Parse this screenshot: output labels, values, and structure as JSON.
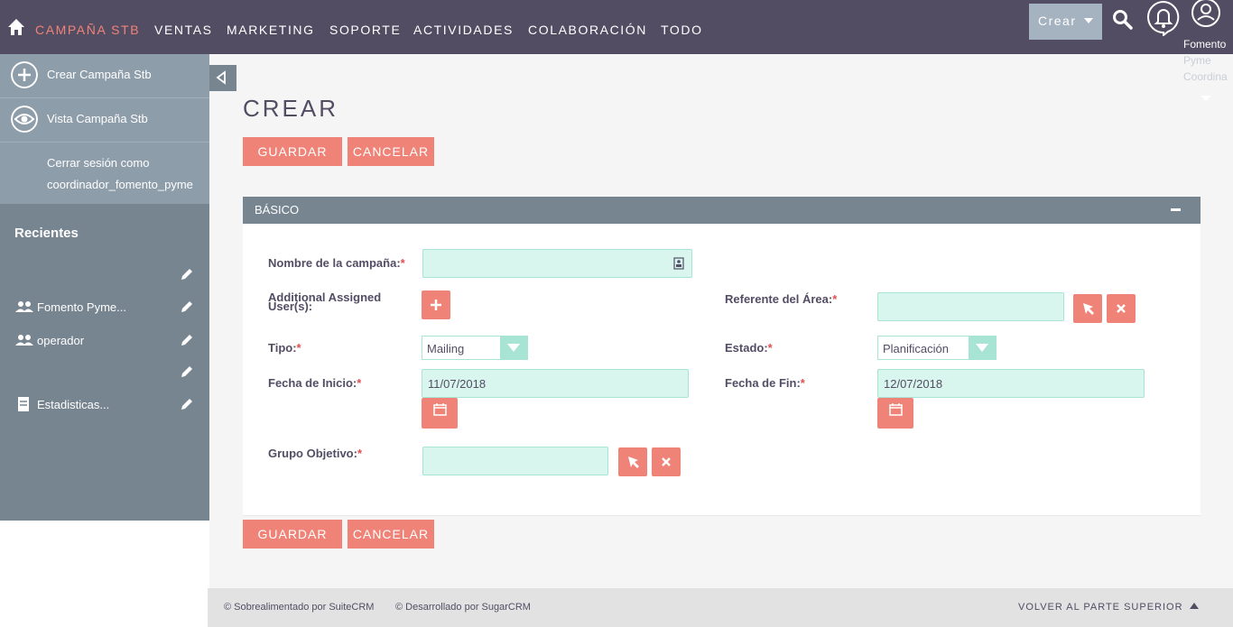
{
  "nav": {
    "home": "home-icon",
    "items": [
      {
        "label": "CAMPAÑA STB",
        "active": true
      },
      {
        "label": "VENTAS"
      },
      {
        "label": "MARKETING"
      },
      {
        "label": "SOPORTE"
      },
      {
        "label": "ACTIVIDADES"
      },
      {
        "label": "COLABORACIÓN"
      },
      {
        "label": "TODO"
      }
    ],
    "create_label": "Crear",
    "user_lines": [
      "Fomento",
      "Pyme",
      "Coordina"
    ]
  },
  "sidebar": {
    "actions": [
      {
        "label": "Crear Campaña Stb",
        "icon": "plus-circle-icon"
      },
      {
        "label": "Vista Campaña Stb",
        "icon": "eye-icon"
      }
    ],
    "logout": [
      "Cerrar sesión como",
      "coordinador_fomento_pyme"
    ],
    "recent_title": "Recientes",
    "recent": [
      {
        "label": "",
        "icon": ""
      },
      {
        "label": "Fomento Pyme...",
        "icon": "users-icon"
      },
      {
        "label": "operador",
        "icon": "users-icon"
      },
      {
        "label": "",
        "icon": ""
      },
      {
        "label": "Estadisticas...",
        "icon": "document-icon"
      }
    ]
  },
  "page": {
    "title": "CREAR",
    "save": "GUARDAR",
    "cancel": "CANCELAR"
  },
  "panel": {
    "title": "BÁSICO",
    "fields": {
      "nombre": {
        "label": "Nombre de la campaña:",
        "value": ""
      },
      "assigned": {
        "label": "Additional Assigned User(s):"
      },
      "referente": {
        "label": "Referente del Área:",
        "value": ""
      },
      "tipo": {
        "label": "Tipo:",
        "value": "Mailing"
      },
      "estado": {
        "label": "Estado:",
        "value": "Planificación"
      },
      "inicio": {
        "label": "Fecha de Inicio:",
        "value": "11/07/2018"
      },
      "fin": {
        "label": "Fecha de Fin:",
        "value": "12/07/2018"
      },
      "grupo": {
        "label": "Grupo Objetivo:",
        "value": ""
      }
    },
    "required_mark": "*"
  },
  "footer": {
    "powered": "© Sobrealimentado por SuiteCRM",
    "developed": "© Desarrollado por SugarCRM",
    "back_to_top": "VOLVER AL PARTE SUPERIOR"
  },
  "colors": {
    "nav_bg": "#534d64",
    "accent": "#f08377",
    "field_bg": "#d8f5ee",
    "sidebar_bg": "#778591"
  }
}
